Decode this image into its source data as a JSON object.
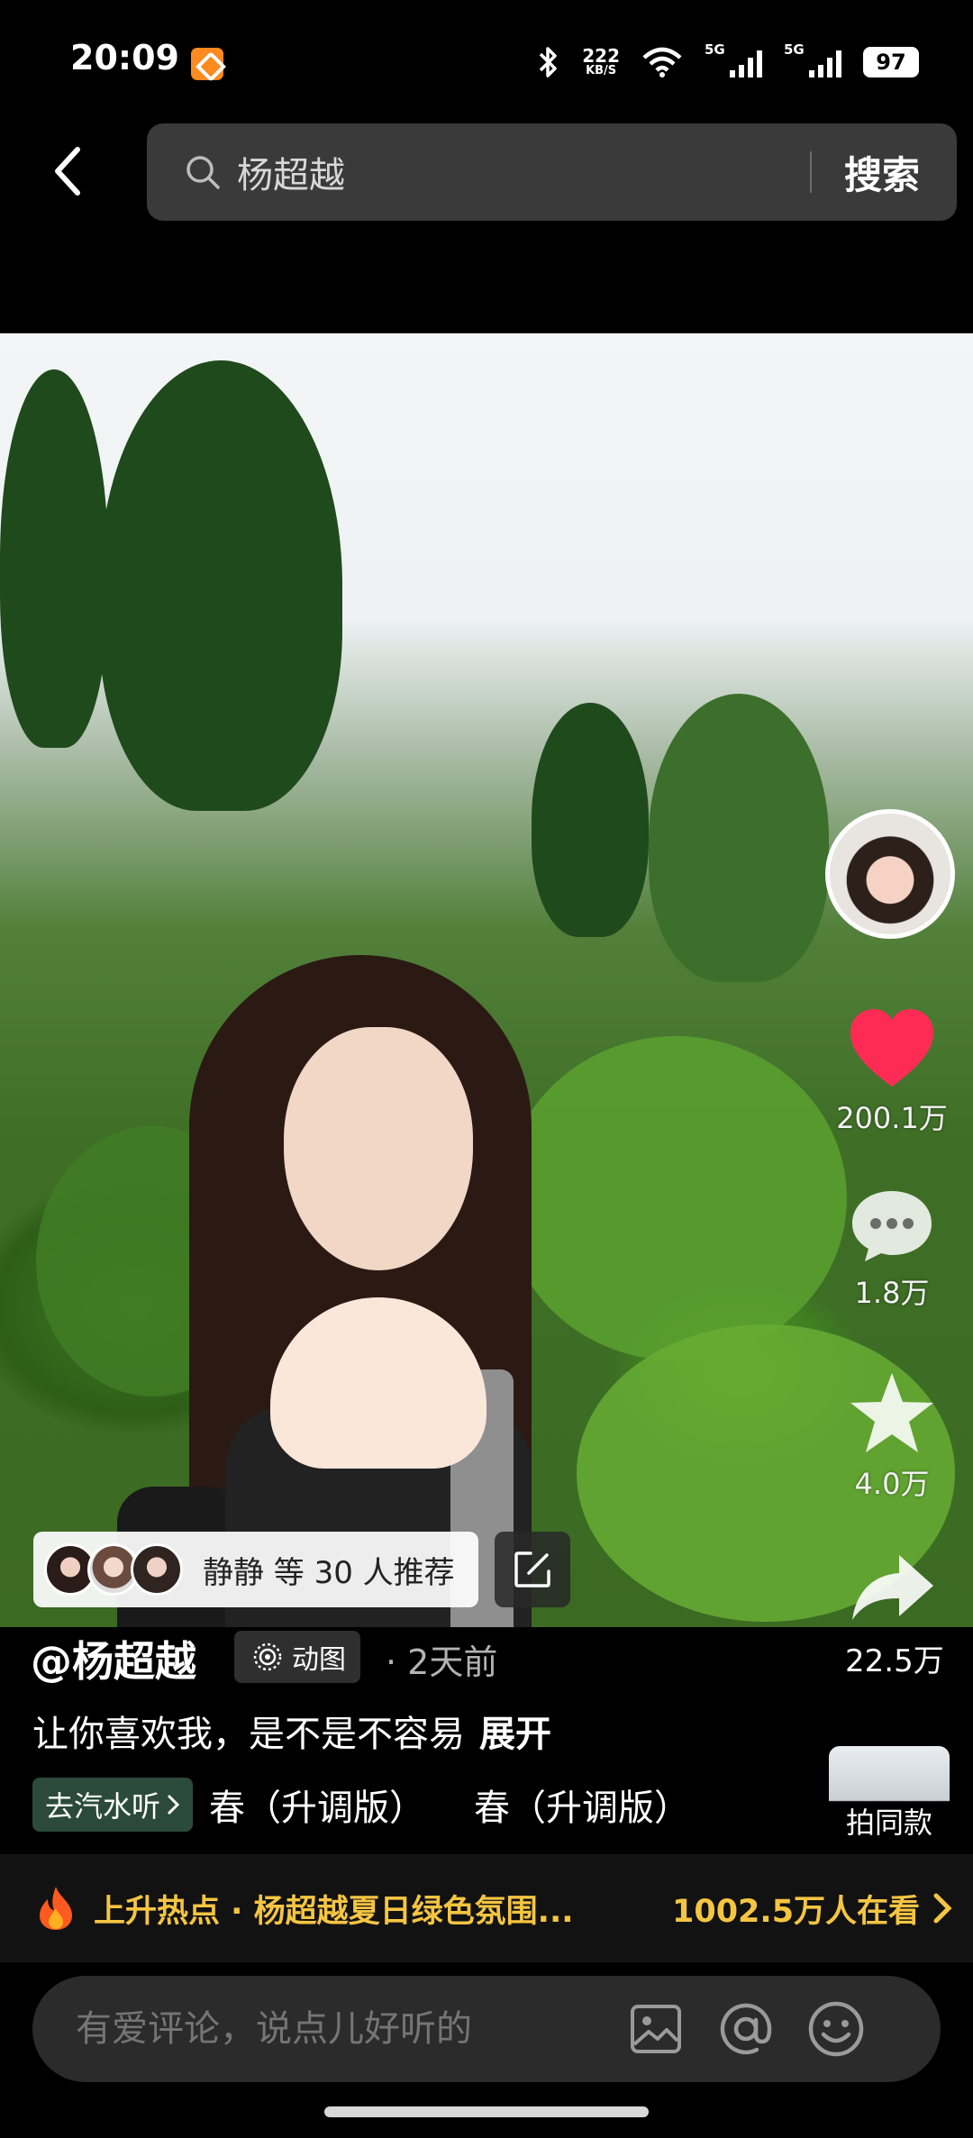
{
  "status_bar": {
    "time": "20:09",
    "net_speed_value": "222",
    "net_speed_unit": "KB/S",
    "sim1_label": "5G",
    "sim2_label": "5G",
    "battery": "97",
    "icons": [
      "app-notification-icon",
      "bluetooth-icon",
      "wifi-icon",
      "signal-icon",
      "battery-icon"
    ]
  },
  "search": {
    "value": "杨超越",
    "button_label": "搜索"
  },
  "post": {
    "author_handle": "@杨超越",
    "type_label": "动图",
    "time": "· 2天前",
    "caption": "让你喜欢我，是不是不容易",
    "expand_label": "展开",
    "recommend_text": "静静 等 30 人推荐"
  },
  "actions": {
    "like_count": "200.1万",
    "comment_count": "1.8万",
    "favorite_count": "4.0万",
    "share_count": "22.5万",
    "like_color": "#fe2c55"
  },
  "music": {
    "tag_label": "去汽水听",
    "track_1": "春（升调版）",
    "track_2": "春（升调版）",
    "same_style_label": "拍同款"
  },
  "hot": {
    "text": "上升热点 · 杨超越夏日绿色氛围...",
    "views": "1002.5万人在看",
    "color": "#f5c542"
  },
  "comment": {
    "placeholder": "有爱评论，说点儿好听的"
  }
}
